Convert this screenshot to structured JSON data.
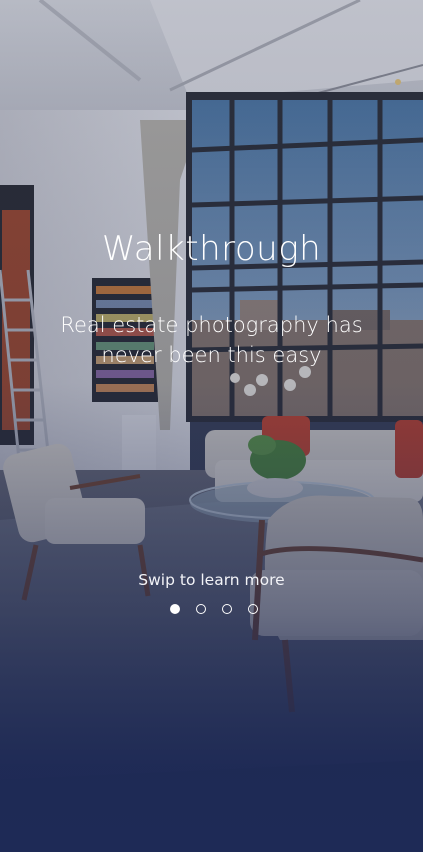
{
  "onboarding": {
    "title": "Walkthrough",
    "subtitle": "Real estate photography has never been this easy",
    "hint": "Swip to learn more",
    "pages": [
      {
        "active": true
      },
      {
        "active": false
      },
      {
        "active": false
      },
      {
        "active": false
      }
    ]
  },
  "colors": {
    "overlay": "#1e2a56",
    "text": "#ffffff"
  },
  "icons": [
    "background-photo"
  ]
}
